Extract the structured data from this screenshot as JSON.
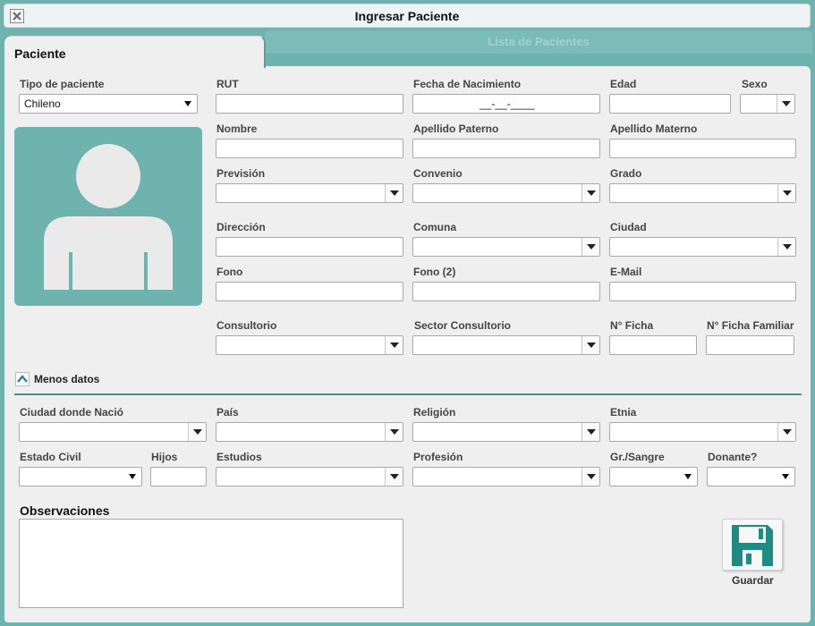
{
  "window": {
    "title": "Ingresar Paciente"
  },
  "background_tab": {
    "label": "Lista de Pacientes"
  },
  "tabs": {
    "active": "Paciente"
  },
  "form": {
    "tipo_paciente": {
      "label": "Tipo de paciente",
      "value": "Chileno"
    },
    "rut": {
      "label": "RUT",
      "value": ""
    },
    "fecha_nacimiento": {
      "label": "Fecha de Nacimiento",
      "value": "__-__-____"
    },
    "edad": {
      "label": "Edad",
      "value": ""
    },
    "sexo": {
      "label": "Sexo",
      "value": ""
    },
    "nombre": {
      "label": "Nombre",
      "value": ""
    },
    "apellido_paterno": {
      "label": "Apellido Paterno",
      "value": ""
    },
    "apellido_materno": {
      "label": "Apellido Materno",
      "value": ""
    },
    "prevision": {
      "label": "Previsión",
      "value": ""
    },
    "convenio": {
      "label": "Convenio",
      "value": ""
    },
    "grado": {
      "label": "Grado",
      "value": ""
    },
    "direccion": {
      "label": "Dirección",
      "value": ""
    },
    "comuna": {
      "label": "Comuna",
      "value": ""
    },
    "ciudad": {
      "label": "Ciudad",
      "value": ""
    },
    "fono": {
      "label": "Fono",
      "value": ""
    },
    "fono2": {
      "label": "Fono (2)",
      "value": ""
    },
    "email": {
      "label": "E-Mail",
      "value": ""
    },
    "consultorio": {
      "label": "Consultorio",
      "value": ""
    },
    "sector_consultorio": {
      "label": "Sector Consultorio",
      "value": ""
    },
    "n_ficha": {
      "label": "N° Ficha",
      "value": ""
    },
    "n_ficha_familiar": {
      "label": "N° Ficha Familiar",
      "value": ""
    },
    "toggle_label": "Menos datos",
    "ciudad_nacio": {
      "label": "Ciudad donde Nació",
      "value": ""
    },
    "pais": {
      "label": "País",
      "value": ""
    },
    "religion": {
      "label": "Religión",
      "value": ""
    },
    "etnia": {
      "label": "Etnia",
      "value": ""
    },
    "estado_civil": {
      "label": "Estado Civil",
      "value": ""
    },
    "hijos": {
      "label": "Hijos",
      "value": ""
    },
    "estudios": {
      "label": "Estudios",
      "value": ""
    },
    "profesion": {
      "label": "Profesión",
      "value": ""
    },
    "gr_sangre": {
      "label": "Gr./Sangre",
      "value": ""
    },
    "donante": {
      "label": "Donante?",
      "value": ""
    },
    "observaciones": {
      "label": "Observaciones",
      "value": ""
    }
  },
  "actions": {
    "save_label": "Guardar"
  },
  "icons": {
    "close": "close-icon",
    "avatar": "user-silhouette-icon",
    "toggle": "chevron-up-icon",
    "save": "floppy-disk-icon"
  },
  "colors": {
    "accent": "#6fb3af",
    "accent_dark": "#2c8582",
    "panel": "#efefef"
  }
}
